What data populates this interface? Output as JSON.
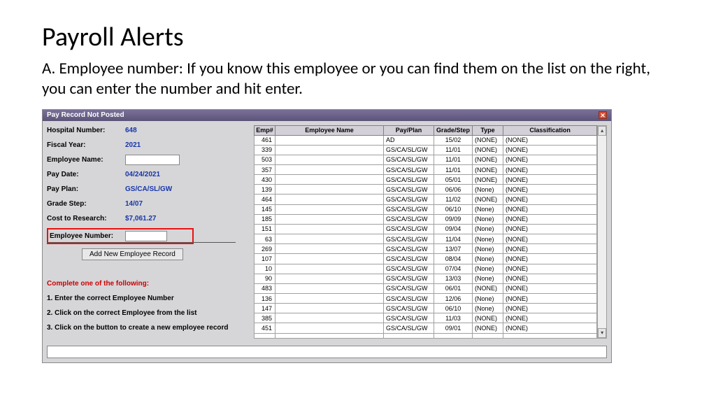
{
  "slide": {
    "title": "Payroll Alerts",
    "body": "A. Employee number: If you know this employee or you can find them on the list on the right, you can enter the number and hit enter."
  },
  "window": {
    "title": "Pay Record Not Posted",
    "form": {
      "hospital_number_label": "Hospital Number:",
      "hospital_number": "648",
      "fiscal_year_label": "Fiscal Year:",
      "fiscal_year": "2021",
      "employee_name_label": "Employee Name:",
      "employee_name": "",
      "pay_date_label": "Pay Date:",
      "pay_date": "04/24/2021",
      "pay_plan_label": "Pay Plan:",
      "pay_plan": "GS/CA/SL/GW",
      "grade_step_label": "Grade Step:",
      "grade_step": "14/07",
      "cost_label": "Cost to Research:",
      "cost": "$7,061.27",
      "employee_number_label": "Employee Number:",
      "employee_number": ""
    },
    "add_button": "Add New Employee Record",
    "instructions_header": "Complete one of the following:",
    "instr1": "1. Enter the correct Employee Number",
    "instr2": "2. Click on the correct Employee from the list",
    "instr3": "3. Click on the button to create a new employee record",
    "grid": {
      "headers": [
        "Emp#",
        "Employee Name",
        "Pay/Plan",
        "Grade/Step",
        "Type",
        "Classification"
      ],
      "rows": [
        {
          "emp": "461",
          "name": "",
          "plan": "AD",
          "gs": "15/02",
          "type": "(NONE)",
          "cls": "(NONE)"
        },
        {
          "emp": "339",
          "name": "",
          "plan": "GS/CA/SL/GW",
          "gs": "11/01",
          "type": "(NONE)",
          "cls": "(NONE)"
        },
        {
          "emp": "503",
          "name": "",
          "plan": "GS/CA/SL/GW",
          "gs": "11/01",
          "type": "(NONE)",
          "cls": "(NONE)"
        },
        {
          "emp": "357",
          "name": "",
          "plan": "GS/CA/SL/GW",
          "gs": "11/01",
          "type": "(NONE)",
          "cls": "(NONE)"
        },
        {
          "emp": "430",
          "name": "",
          "plan": "GS/CA/SL/GW",
          "gs": "05/01",
          "type": "(NONE)",
          "cls": "(NONE)"
        },
        {
          "emp": "139",
          "name": "",
          "plan": "GS/CA/SL/GW",
          "gs": "06/06",
          "type": "(None)",
          "cls": "(NONE)"
        },
        {
          "emp": "464",
          "name": "",
          "plan": "GS/CA/SL/GW",
          "gs": "11/02",
          "type": "(NONE)",
          "cls": "(NONE)"
        },
        {
          "emp": "145",
          "name": "",
          "plan": "GS/CA/SL/GW",
          "gs": "06/10",
          "type": "(None)",
          "cls": "(NONE)"
        },
        {
          "emp": "185",
          "name": "",
          "plan": "GS/CA/SL/GW",
          "gs": "09/09",
          "type": "(None)",
          "cls": "(NONE)"
        },
        {
          "emp": "151",
          "name": "",
          "plan": "GS/CA/SL/GW",
          "gs": "09/04",
          "type": "(None)",
          "cls": "(NONE)"
        },
        {
          "emp": "63",
          "name": "",
          "plan": "GS/CA/SL/GW",
          "gs": "11/04",
          "type": "(None)",
          "cls": "(NONE)"
        },
        {
          "emp": "269",
          "name": "",
          "plan": "GS/CA/SL/GW",
          "gs": "13/07",
          "type": "(None)",
          "cls": "(NONE)"
        },
        {
          "emp": "107",
          "name": "",
          "plan": "GS/CA/SL/GW",
          "gs": "08/04",
          "type": "(None)",
          "cls": "(NONE)"
        },
        {
          "emp": "10",
          "name": "",
          "plan": "GS/CA/SL/GW",
          "gs": "07/04",
          "type": "(None)",
          "cls": "(NONE)"
        },
        {
          "emp": "90",
          "name": "",
          "plan": "GS/CA/SL/GW",
          "gs": "13/03",
          "type": "(None)",
          "cls": "(NONE)"
        },
        {
          "emp": "483",
          "name": "",
          "plan": "GS/CA/SL/GW",
          "gs": "06/01",
          "type": "(NONE)",
          "cls": "(NONE)"
        },
        {
          "emp": "136",
          "name": "",
          "plan": "GS/CA/SL/GW",
          "gs": "12/06",
          "type": "(None)",
          "cls": "(NONE)"
        },
        {
          "emp": "147",
          "name": "",
          "plan": "GS/CA/SL/GW",
          "gs": "06/10",
          "type": "(None)",
          "cls": "(NONE)"
        },
        {
          "emp": "385",
          "name": "",
          "plan": "GS/CA/SL/GW",
          "gs": "11/03",
          "type": "(NONE)",
          "cls": "(NONE)"
        },
        {
          "emp": "451",
          "name": "",
          "plan": "GS/CA/SL/GW",
          "gs": "09/01",
          "type": "(NONE)",
          "cls": "(NONE)"
        }
      ]
    }
  }
}
